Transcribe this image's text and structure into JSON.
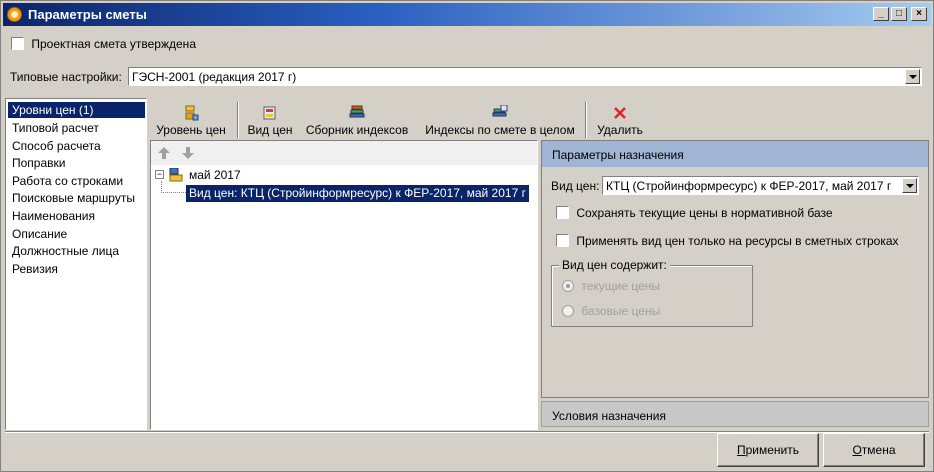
{
  "window": {
    "title": "Параметры сметы",
    "min_label": "_",
    "max_label": "□",
    "close_label": "×"
  },
  "approved_checkbox": {
    "label": "Проектная смета утверждена",
    "checked": false
  },
  "preset": {
    "label": "Типовые настройки:",
    "value": "ГЭСН-2001 (редакция 2017 г)"
  },
  "nav": {
    "items": [
      {
        "label": "Уровни цен (1)",
        "selected": true
      },
      {
        "label": "Типовой расчет"
      },
      {
        "label": "Способ расчета"
      },
      {
        "label": "Поправки"
      },
      {
        "label": "Работа со строками"
      },
      {
        "label": "Поисковые маршруты"
      },
      {
        "label": "Наименования"
      },
      {
        "label": "Описание"
      },
      {
        "label": "Должностные лица"
      },
      {
        "label": "Ревизия"
      }
    ]
  },
  "toolbar": {
    "price_level": "Уровень цен",
    "price_kind": "Вид цен",
    "index_collection": "Сборник индексов",
    "estimate_indices": "Индексы по смете в целом",
    "delete": "Удалить"
  },
  "tree": {
    "root_label": "май 2017",
    "child_label": "Вид цен: КТЦ (Стройинформресурс) к ФЕР-2017, май 2017 г",
    "expander": "−"
  },
  "params_panel": {
    "header": "Параметры назначения",
    "price_kind_label": "Вид цен:",
    "price_kind_value": "КТЦ (Стройинформресурс) к ФЕР-2017, май 2017 г",
    "save_current_prices": "Сохранять текущие цены в нормативной базе",
    "apply_only_resources": "Применять вид цен только на ресурсы в сметных строках",
    "contains_group": "Вид цен содержит:",
    "option_current": "текущие цены",
    "option_base": "базовые цены",
    "selected_option": "текущие цены"
  },
  "conditions_panel": {
    "header": "Условия назначения"
  },
  "buttons": {
    "apply_u": "П",
    "apply_rest": "рименить",
    "cancel_u": "О",
    "cancel_rest": "тмена"
  },
  "colors": {
    "title_start": "#0a246a",
    "selection": "#0a246a",
    "panel_header": "#a0b4d4",
    "delete_icon": "#e02020"
  }
}
